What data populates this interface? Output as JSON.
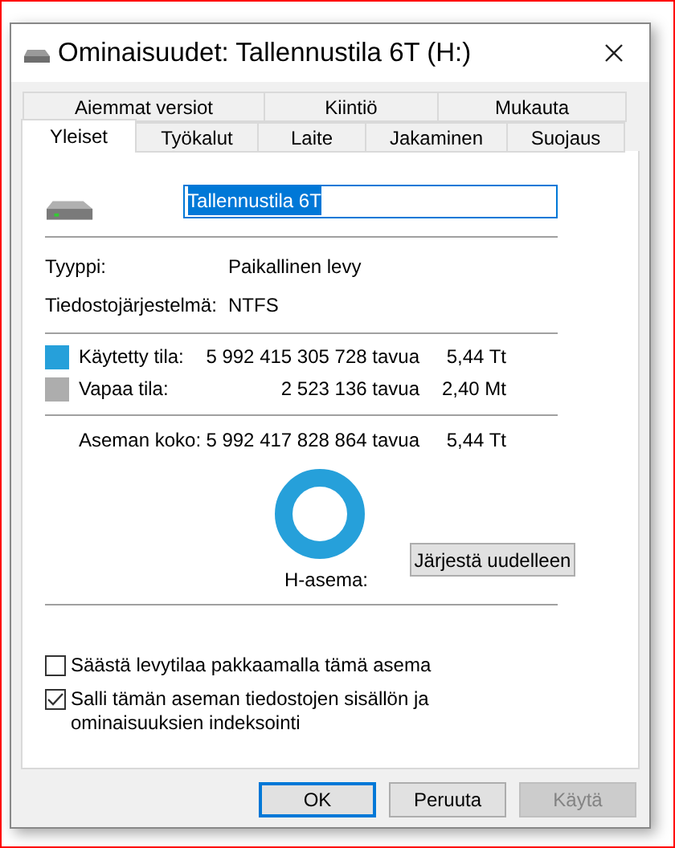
{
  "window": {
    "title": "Ominaisuudet: Tallennustila 6T (H:)"
  },
  "tab_rows": [
    {
      "tabs": [
        {
          "label": "Aiemmat versiot",
          "selected": false
        },
        {
          "label": "Kiintiö",
          "selected": false
        },
        {
          "label": "Mukauta",
          "selected": false
        }
      ]
    },
    {
      "tabs": [
        {
          "label": "Yleiset",
          "selected": true
        },
        {
          "label": "Työkalut",
          "selected": false
        },
        {
          "label": "Laite",
          "selected": false
        },
        {
          "label": "Jakaminen",
          "selected": false
        },
        {
          "label": "Suojaus",
          "selected": false
        }
      ]
    }
  ],
  "name_field": {
    "value": "Tallennustila 6T",
    "text_selected": true
  },
  "info": [
    {
      "label": "Tyyppi:",
      "value": "Paikallinen levy"
    },
    {
      "label": "Tiedostojärjestelmä:",
      "value": "NTFS"
    }
  ],
  "space": [
    {
      "label": "Käytetty tila:",
      "bytes": "5 992 415 305 728 tavua",
      "size": "5,44 Tt",
      "color": "#26a0da"
    },
    {
      "label": "Vapaa tila:",
      "bytes": "2 523 136 tavua",
      "size": "2,40 Mt",
      "color": "#adadad"
    }
  ],
  "capacity": {
    "label": "Aseman koko:",
    "bytes": "5 992 417 828 864 tavua",
    "size": "5,44 Tt"
  },
  "drive_label": "H-asema:",
  "cleanup_button": "Järjestä uudelleen",
  "options": [
    {
      "label": "Säästä levytilaa pakkaamalla tämä asema",
      "checked": false
    },
    {
      "label": "Salli tämän aseman tiedostojen sisällön ja ominaisuuksien indeksointi",
      "checked": true
    }
  ],
  "buttons": [
    {
      "label": "OK",
      "default": true,
      "disabled": false
    },
    {
      "label": "Peruuta",
      "default": false,
      "disabled": false
    },
    {
      "label": "Käytä",
      "default": false,
      "disabled": true
    }
  ]
}
